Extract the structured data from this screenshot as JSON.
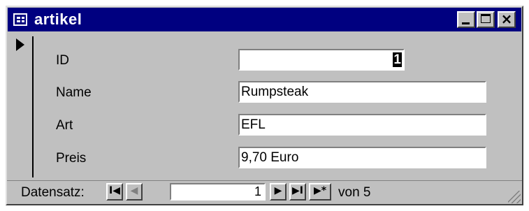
{
  "window": {
    "title": "artikel",
    "icon": "form-icon",
    "controls": {
      "minimize": "minimize-icon",
      "maximize": "maximize-icon",
      "close": "×"
    }
  },
  "record_selector": {
    "icon": "current-record-arrow-icon"
  },
  "fields": [
    {
      "label": "ID",
      "value": "1"
    },
    {
      "label": "Name",
      "value": "Rumpsteak"
    },
    {
      "label": "Art",
      "value": "EFL"
    },
    {
      "label": "Preis",
      "value": "9,70 Euro"
    }
  ],
  "navigation": {
    "label": "Datensatz:",
    "current_record": "1",
    "total_text": "von 5",
    "buttons": {
      "first": "I◀",
      "previous": "◀",
      "next": "▶",
      "last": "▶I",
      "new": "▶*"
    }
  },
  "colors": {
    "titlebar": "#000080",
    "window_background": "#c0c0c0",
    "input_background": "#ffffff"
  }
}
